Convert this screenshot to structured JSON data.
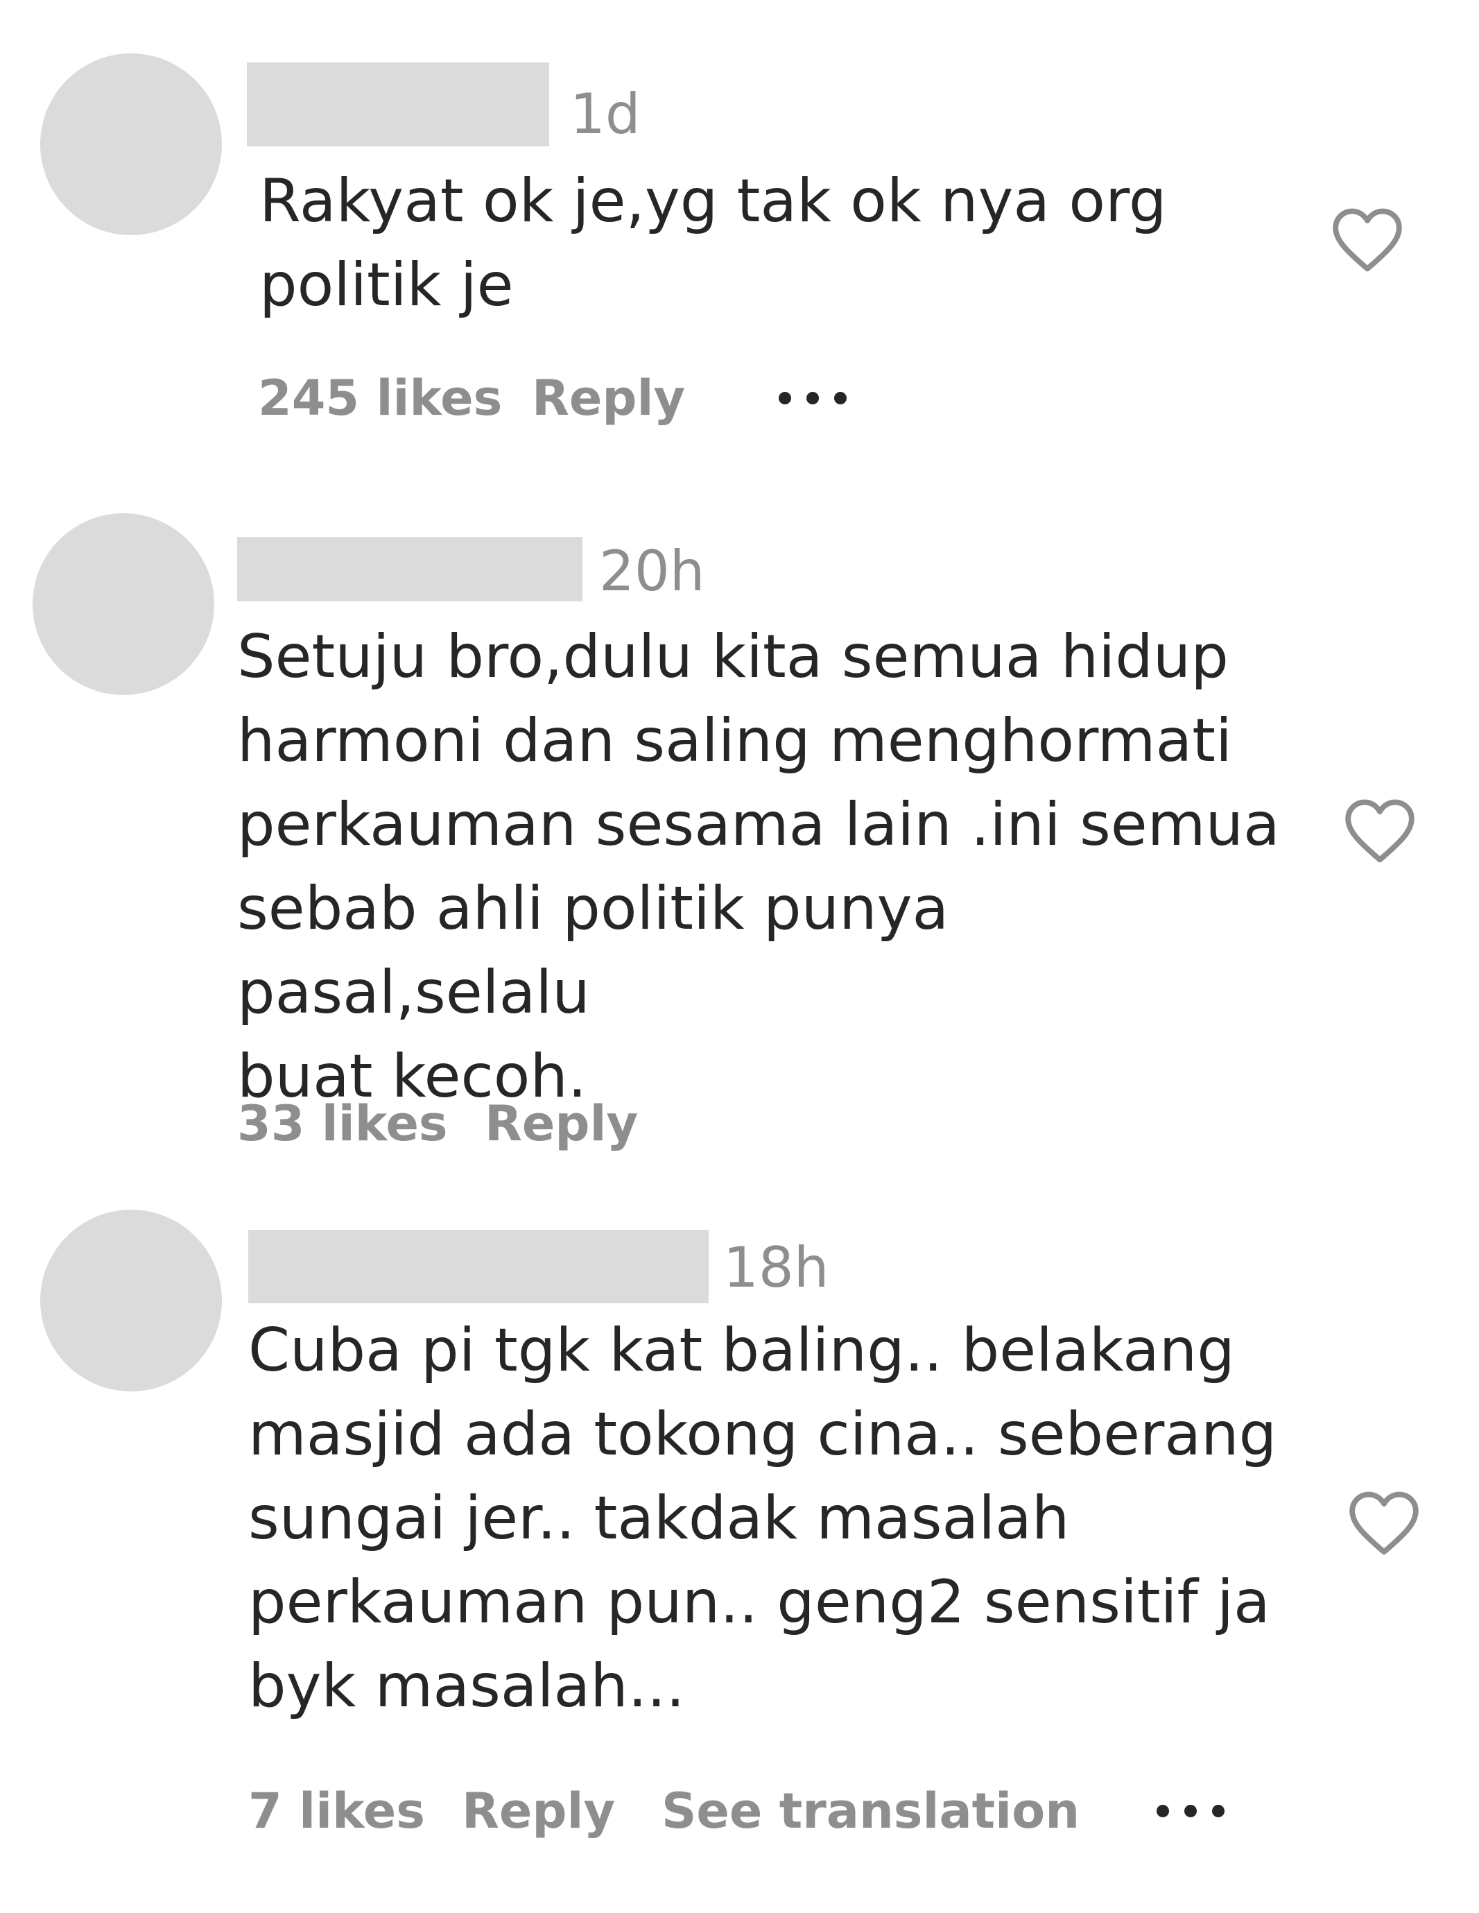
{
  "comments": [
    {
      "timestamp": "1d",
      "text": "Rakyat ok je,yg tak ok nya org\npolitik je",
      "likes": "245 likes",
      "reply": "Reply",
      "see_translation": null
    },
    {
      "timestamp": "20h",
      "text": "Setuju bro,dulu kita semua hidup\nharmoni dan saling menghormati\nperkauman sesama lain .ini semua\nsebab ahli politik punya pasal,selalu\nbuat kecoh.",
      "likes": "33 likes",
      "reply": "Reply",
      "see_translation": null
    },
    {
      "timestamp": "18h",
      "text": "Cuba pi tgk kat baling.. belakang\nmasjid ada tokong cina.. seberang\nsungai jer.. takdak masalah\nperkauman pun.. geng2 sensitif ja\nbyk masalah...",
      "likes": "7 likes",
      "reply": "Reply",
      "see_translation": "See translation"
    }
  ],
  "colors": {
    "redaction": "#dbdbdb",
    "text": "#262626",
    "muted": "#8e8e8e"
  },
  "icons": {
    "like": "heart-outline-icon",
    "more": "more-horizontal-icon"
  }
}
